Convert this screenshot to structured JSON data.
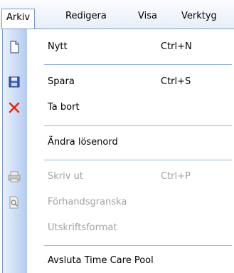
{
  "menubar": {
    "items": [
      {
        "label": "Arkiv"
      },
      {
        "label": "Redigera"
      },
      {
        "label": "Visa"
      },
      {
        "label": "Verktyg"
      }
    ]
  },
  "menu": {
    "items": [
      {
        "label": "Nytt",
        "shortcut": "Ctrl+N",
        "icon": "new-document-icon"
      },
      {
        "label": "Spara",
        "shortcut": "Ctrl+S",
        "icon": "save-disk-icon"
      },
      {
        "label": "Ta bort",
        "shortcut": "",
        "icon": "delete-x-icon"
      },
      {
        "label": "Ändra lösenord",
        "shortcut": "",
        "icon": ""
      },
      {
        "label": "Skriv ut",
        "shortcut": "Ctrl+P",
        "icon": "printer-icon",
        "disabled": true
      },
      {
        "label": "Förhandsgranska",
        "shortcut": "",
        "icon": "print-preview-icon",
        "disabled": true
      },
      {
        "label": "Utskriftsformat",
        "shortcut": "",
        "icon": "",
        "disabled": true
      },
      {
        "label": "Avsluta Time Care Pool",
        "shortcut": "",
        "icon": ""
      }
    ]
  },
  "colors": {
    "accent_border": "#7b9cd2",
    "gutter_light": "#eaf1fc",
    "gutter_dark": "#b3cbf0",
    "disabled_text": "#a2a2a2",
    "delete_red": "#e02a1a"
  }
}
